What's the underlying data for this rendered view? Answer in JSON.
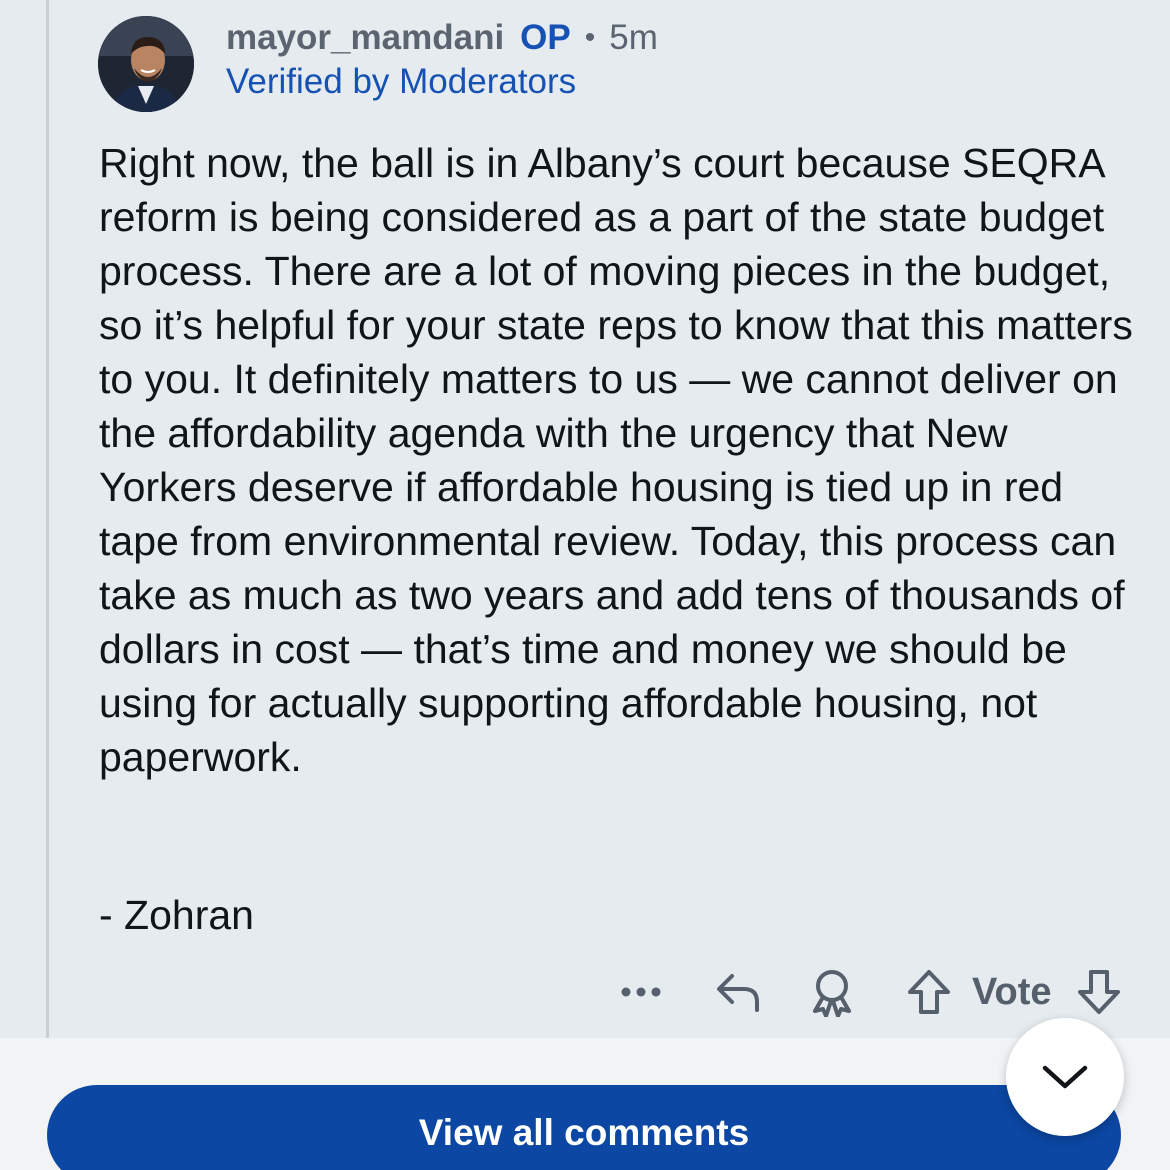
{
  "comment": {
    "author": "mayor_mamdani",
    "op_label": "OP",
    "separator": "•",
    "time_ago": "5m",
    "flair": "Verified by Moderators",
    "body": "Right now, the ball is in Albany’s court because SEQRA reform is being considered as a part of the state budget process. There are a lot of moving pieces in the budget, so it’s helpful for your state reps to know that this matters to you. It definitely matters to us — we cannot deliver on the affordability agenda with the urgency that New Yorkers deserve if affordable housing is tied up in red tape from environmental review. Today, this process can take as much as two years and add tens of thousands of dollars in cost — that’s time and money we should be using for actually supporting affordable housing, not paperwork.",
    "signature": "- Zohran"
  },
  "actions": {
    "more_icon": "more-horizontal-icon",
    "reply_icon": "reply-arrow-icon",
    "award_icon": "award-icon",
    "upvote_icon": "upvote-arrow-icon",
    "vote_label": "Vote",
    "downvote_icon": "downvote-arrow-icon"
  },
  "footer": {
    "view_all_label": "View all comments",
    "collapse_icon": "chevron-down-icon"
  },
  "colors": {
    "background": "#e5ebef",
    "accent_blue": "#1652b4",
    "button_blue": "#0b47a3",
    "muted_text": "#5b6470"
  }
}
